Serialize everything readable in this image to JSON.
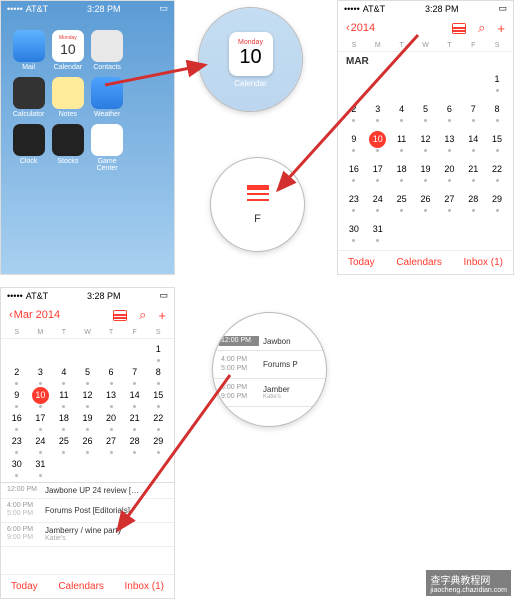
{
  "status": {
    "carrier": "AT&T",
    "time": "3:28 PM",
    "signal": "•••••"
  },
  "home": {
    "apps": [
      {
        "name": "Mail",
        "cls": "icon-mail"
      },
      {
        "name": "Calendar",
        "cls": "icon-cal",
        "day": "Monday",
        "num": "10"
      },
      {
        "name": "Contacts",
        "cls": "icon-contacts"
      },
      {
        "name": "",
        "cls": ""
      },
      {
        "name": "Calculator",
        "cls": "icon-calc"
      },
      {
        "name": "Notes",
        "cls": "icon-notes"
      },
      {
        "name": "Weather",
        "cls": "icon-weather"
      },
      {
        "name": "",
        "cls": ""
      },
      {
        "name": "Clock",
        "cls": "icon-clock"
      },
      {
        "name": "Stocks",
        "cls": "icon-stocks"
      },
      {
        "name": "Game Center",
        "cls": "icon-gc"
      },
      {
        "name": "",
        "cls": ""
      }
    ]
  },
  "zoom_cal": {
    "day": "Monday",
    "num": "10",
    "label": "Calendar"
  },
  "zoom_list": {
    "label": "F"
  },
  "calendar": {
    "back": "2014",
    "month": "MAR",
    "month_full": "Mar 2014",
    "dow": [
      "S",
      "M",
      "T",
      "W",
      "T",
      "F",
      "S"
    ],
    "days": [
      "",
      "",
      "",
      "",
      "",
      "",
      "1",
      "2",
      "3",
      "4",
      "5",
      "6",
      "7",
      "8",
      "9",
      "10",
      "11",
      "12",
      "13",
      "14",
      "15",
      "16",
      "17",
      "18",
      "19",
      "20",
      "21",
      "22",
      "23",
      "24",
      "25",
      "26",
      "27",
      "28",
      "29",
      "30",
      "31",
      "",
      "",
      "",
      "",
      ""
    ],
    "today_index": 9,
    "footer": {
      "today": "Today",
      "calendars": "Calendars",
      "inbox": "Inbox (1)"
    }
  },
  "events": [
    {
      "t1": "12:00 PM",
      "t2": "",
      "title": "Jawbone UP 24 review […"
    },
    {
      "t1": "4:00 PM",
      "t2": "5:00 PM",
      "title": "Forums Post [Editorials]"
    },
    {
      "t1": "6:00 PM",
      "t2": "9:00 PM",
      "title": "Jamberry / wine party",
      "sub": "Katie's"
    }
  ],
  "zoom_events": [
    {
      "t1": "12:00 PM",
      "t2": "",
      "title": "Jawbon"
    },
    {
      "t1": "4:00 PM",
      "t2": "5:00 PM",
      "title": "Forums P"
    },
    {
      "t1": "6:00 PM",
      "t2": "9:00 PM",
      "title": "Jamber",
      "sub": "Katie's"
    }
  ],
  "watermark": {
    "main": "查字典教程网",
    "sub": "jiaocheng.chazidian.com"
  },
  "colors": {
    "accent": "#ff3b30"
  }
}
